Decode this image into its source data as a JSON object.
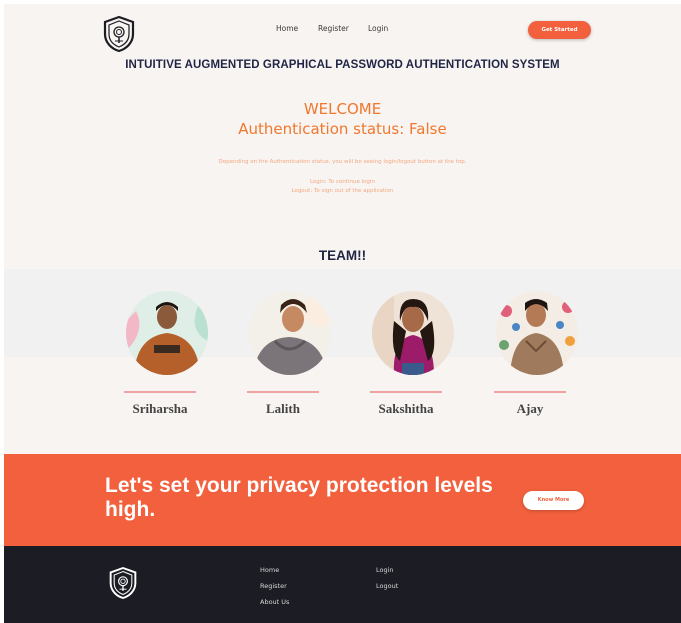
{
  "header": {
    "logo_icon": "shield-fingerprint-icon",
    "nav": {
      "home": "Home",
      "register": "Register",
      "login": "Login"
    },
    "cta_label": "Get Started",
    "site_title": "INTUITIVE AUGMENTED GRAPHICAL PASSWORD AUTHENTICATION SYSTEM"
  },
  "hero": {
    "welcome": "WELCOME",
    "auth_status": "Authentication status: False",
    "info": "Depending on the Authentication status, you will be seeing login/logout button at the top.",
    "login_hint": "Login:  To continue login",
    "logout_hint": "Logout: To sign out of the application"
  },
  "team": {
    "title": "TEAM!!",
    "members": [
      {
        "name": "Sriharsha"
      },
      {
        "name": "Lalith"
      },
      {
        "name": "Sakshitha"
      },
      {
        "name": "Ajay"
      }
    ]
  },
  "banner": {
    "headline": "Let's set your privacy protection levels high.",
    "button_label": "Know More"
  },
  "footer": {
    "logo_icon": "shield-fingerprint-icon",
    "links_col1": [
      "Home",
      "Register",
      "About Us"
    ],
    "links_col2": [
      "Login",
      "Logout"
    ]
  },
  "colors": {
    "accent": "#f2603d",
    "heading": "#1f2545",
    "welcome": "#f0772e",
    "footer_bg": "#1c1d24",
    "background": "#f8f4f1"
  }
}
